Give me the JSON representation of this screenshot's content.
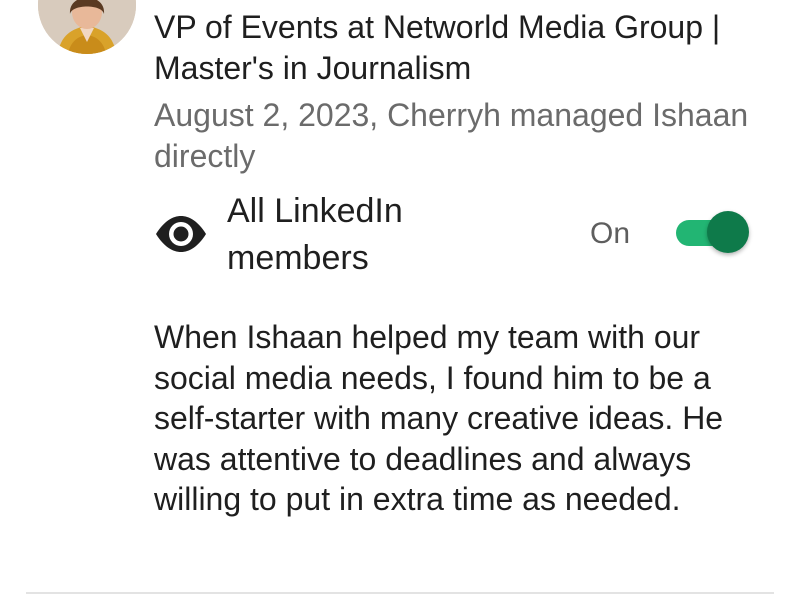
{
  "recommender": {
    "headline": "VP of Events at Networld Media Group | Master's in Journalism",
    "meta": "August 2, 2023, Cherryh managed Ishaan directly"
  },
  "visibility": {
    "label": "All LinkedIn members",
    "toggle_state": "On",
    "toggle_on": true,
    "icon": "eye-icon"
  },
  "recommendation": {
    "text": "When Ishaan helped my team with our social media needs, I found him to be a self-starter with many creative ideas. He was attentive to deadlines and always willing to put in extra time as needed."
  },
  "colors": {
    "toggle_track": "#22b573",
    "toggle_thumb": "#0e7a4a",
    "secondary_text": "#6b6b6b"
  }
}
